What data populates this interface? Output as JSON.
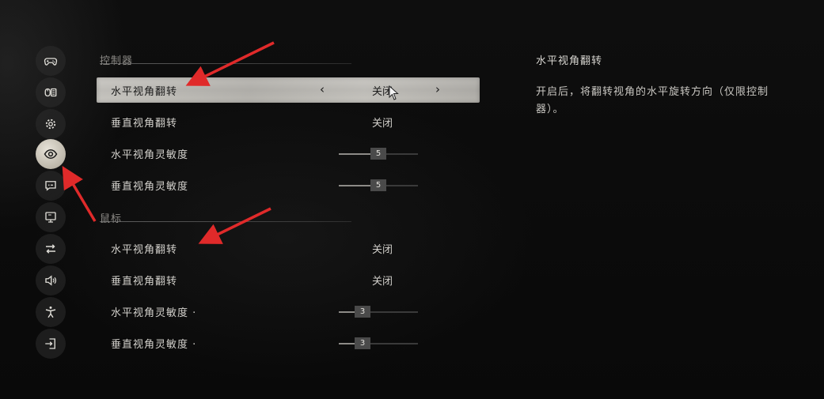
{
  "sidebar": {
    "items": [
      {
        "icon": "gamepad-icon",
        "active": false
      },
      {
        "icon": "keyboard-mouse-icon",
        "active": false
      },
      {
        "icon": "gear-icon",
        "active": false
      },
      {
        "icon": "eye-icon",
        "active": true
      },
      {
        "icon": "subtitle-icon",
        "active": false
      },
      {
        "icon": "monitor-icon",
        "active": false
      },
      {
        "icon": "swap-arrows-icon",
        "active": false
      },
      {
        "icon": "speaker-icon",
        "active": false
      },
      {
        "icon": "accessibility-icon",
        "active": false
      },
      {
        "icon": "exit-icon",
        "active": false
      }
    ]
  },
  "sections": [
    {
      "title": "控制器",
      "rows": [
        {
          "label": "水平视角翻转",
          "value": "关闭",
          "type": "toggle",
          "selected": true
        },
        {
          "label": "垂直视角翻转",
          "value": "关闭",
          "type": "toggle",
          "selected": false
        },
        {
          "label": "水平视角灵敏度",
          "value": "5",
          "type": "slider",
          "fraction": 0.5
        },
        {
          "label": "垂直视角灵敏度",
          "value": "5",
          "type": "slider",
          "fraction": 0.5
        }
      ]
    },
    {
      "title": "鼠标",
      "rows": [
        {
          "label": "水平视角翻转",
          "value": "关闭",
          "type": "toggle",
          "selected": false
        },
        {
          "label": "垂直视角翻转",
          "value": "关闭",
          "type": "toggle",
          "selected": false
        },
        {
          "label": "水平视角灵敏度 ·",
          "value": "3",
          "type": "slider",
          "fraction": 0.3
        },
        {
          "label": "垂直视角灵敏度 ·",
          "value": "3",
          "type": "slider",
          "fraction": 0.3
        }
      ]
    }
  ],
  "selector": {
    "left_arrow": "‹",
    "right_arrow": "›"
  },
  "description": {
    "title": "水平视角翻转",
    "text": "开启后，将翻转视角的水平旋转方向（仅限控制器）。"
  },
  "colors": {
    "accent": "#e02a2a",
    "selected_row": "#c2c0bb",
    "text": "#d2d0cb"
  }
}
